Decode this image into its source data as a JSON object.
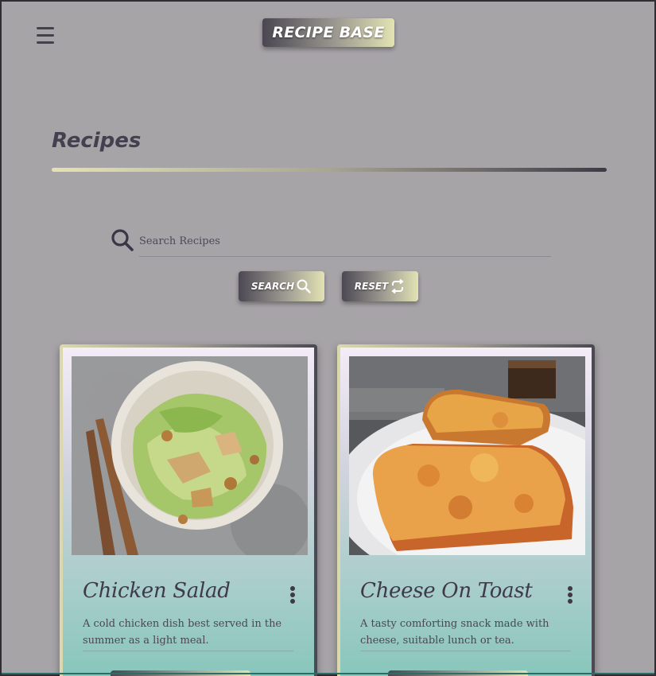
{
  "header": {
    "brand": "RECIPE BASE"
  },
  "page": {
    "title": "Recipes"
  },
  "search": {
    "placeholder": "Search Recipes",
    "value": "",
    "search_label": "SEARCH",
    "reset_label": "RESET"
  },
  "recipes": [
    {
      "title": "Chicken Salad",
      "description": "A cold chicken dish best served in the summer as a light meal."
    },
    {
      "title": "Cheese On Toast",
      "description": "A tasty comforting snack made with cheese, suitable lunch or tea."
    }
  ],
  "colors": {
    "background": "#a7a4a8",
    "text_dark": "#45404f",
    "accent_light": "#e3e3b4",
    "accent_dark": "#4a4752",
    "card_teal": "#82c5b9"
  },
  "icons": {
    "menu": "hamburger-icon",
    "search": "magnifier-icon",
    "reset": "refresh-icon",
    "card_menu": "vertical-dots-icon"
  }
}
